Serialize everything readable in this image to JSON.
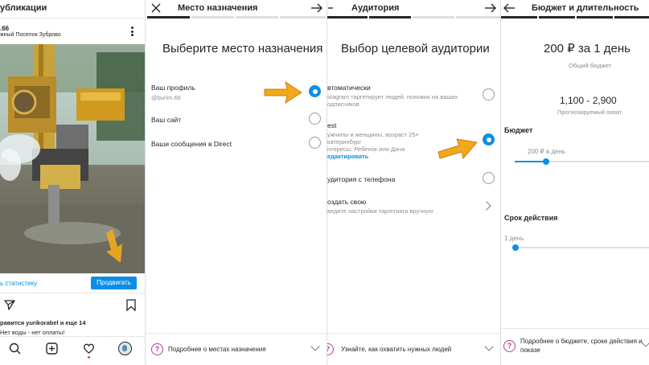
{
  "colors": {
    "accent": "#0b8ee6",
    "arrow": "#f0a91c",
    "help_icon": "#b33d9b"
  },
  "pane1": {
    "title": "убликации",
    "user": ".66",
    "location": "жный Поселок Зуброво",
    "stats_link": "ь статистику",
    "promote_button": "Продвигать",
    "likes": "равится yurikorabel и еще 14",
    "caption": "Нет воды - нет оплаты!"
  },
  "pane2": {
    "title": "Место назначения",
    "heading": "Выберите место назначения",
    "options": [
      {
        "label": "Ваш профиль",
        "sub": "@burim.66",
        "selected": true
      },
      {
        "label": "Ваш сайт",
        "sub": "",
        "selected": false
      },
      {
        "label": "Ваши сообщения в Direct",
        "sub": "",
        "selected": false
      }
    ],
    "footer": "Подробнее о местах назначения"
  },
  "pane3": {
    "title": "Аудитория",
    "heading": "Выбор целевой аудитории",
    "auto_label": "втоматически",
    "auto_sub1": "stagram таргетирует людей, похожих на ваших",
    "auto_sub2": "одписчиков",
    "test_label": "est",
    "test_sub1": "ужчины и женщины, возраст 25+",
    "test_sub2": "катеринбург",
    "test_sub3": "нтересы: Ребенок или Дача",
    "test_edit": "едактировать",
    "phone_label": "удитория с телефона",
    "create_label": "оздать свою",
    "create_sub": "ведите настройки таргетинга вручную",
    "footer": "Узнайте, как охватить нужных людей"
  },
  "pane4": {
    "title": "Бюджет и длительность",
    "budget_line": "200 ₽ за 1 день",
    "budget_caption": "Общий бюджет",
    "reach": "1,100 - 2,900",
    "reach_caption": "Прогнозируемый охват",
    "budget_heading": "Бюджет",
    "budget_value": "200 ₽ в день",
    "budget_slider_fraction": 0.23,
    "duration_heading": "Срок действия",
    "duration_value": "1 день",
    "duration_slider_fraction": 0.0,
    "footer_line1": "Подробнее о бюджете, сроке действия и",
    "footer_line2": "показе"
  }
}
